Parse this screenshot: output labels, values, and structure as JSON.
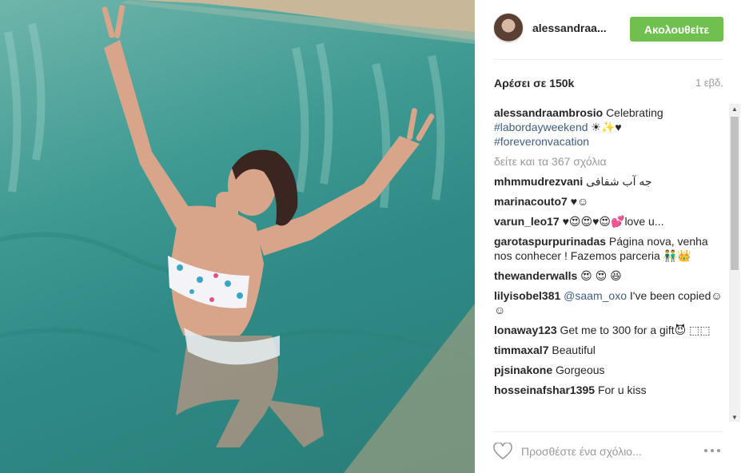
{
  "header": {
    "username": "alessandraa...",
    "follow_label": "Ακολουθείτε"
  },
  "stats": {
    "likes": "Αρέσει σε 150k",
    "age": "1 εβδ."
  },
  "caption": {
    "user": "alessandraambrosio",
    "text": "Celebrating",
    "hashtag1": "#labordayweekend",
    "emoji1": "☀✨♥",
    "hashtag2": "#foreveronvacation"
  },
  "load_more": "δείτε και τα 367 σχόλια",
  "comments": [
    {
      "user": "mhmmudrezvani",
      "text": "جه آب شفافی"
    },
    {
      "user": "marinacouto7",
      "text": "♥☺"
    },
    {
      "user": "varun_leo17",
      "text": "♥😍😍♥😍💕love u..."
    },
    {
      "user": "garotaspurpurinadas",
      "text": "Página nova, venha nos conhecer ! Fazemos parceria 👬👑"
    },
    {
      "user": "thewanderwalls",
      "text": "😍 😍 😆"
    },
    {
      "user": "lilyisobel381",
      "mention": "@saam_oxo",
      "text": "I've been copied☺☺"
    },
    {
      "user": "lonaway123",
      "text": "Get me to 300 for a gift😈 ⬚⬚"
    },
    {
      "user": "timmaxal7",
      "text": "Beautiful"
    },
    {
      "user": "pjsinakone",
      "text": "Gorgeous"
    },
    {
      "user": "hosseinafshar1395",
      "text": "For u kiss"
    }
  ],
  "footer": {
    "comment_placeholder": "Προσθέστε ένα σχόλιο..."
  },
  "colors": {
    "follow_bg": "#70c050",
    "hashtag": "#3c5e86",
    "muted": "#999999",
    "pool_water": "#3f9a93"
  },
  "icons": {
    "like": "heart-outline-icon",
    "more": "more-options-icon"
  }
}
